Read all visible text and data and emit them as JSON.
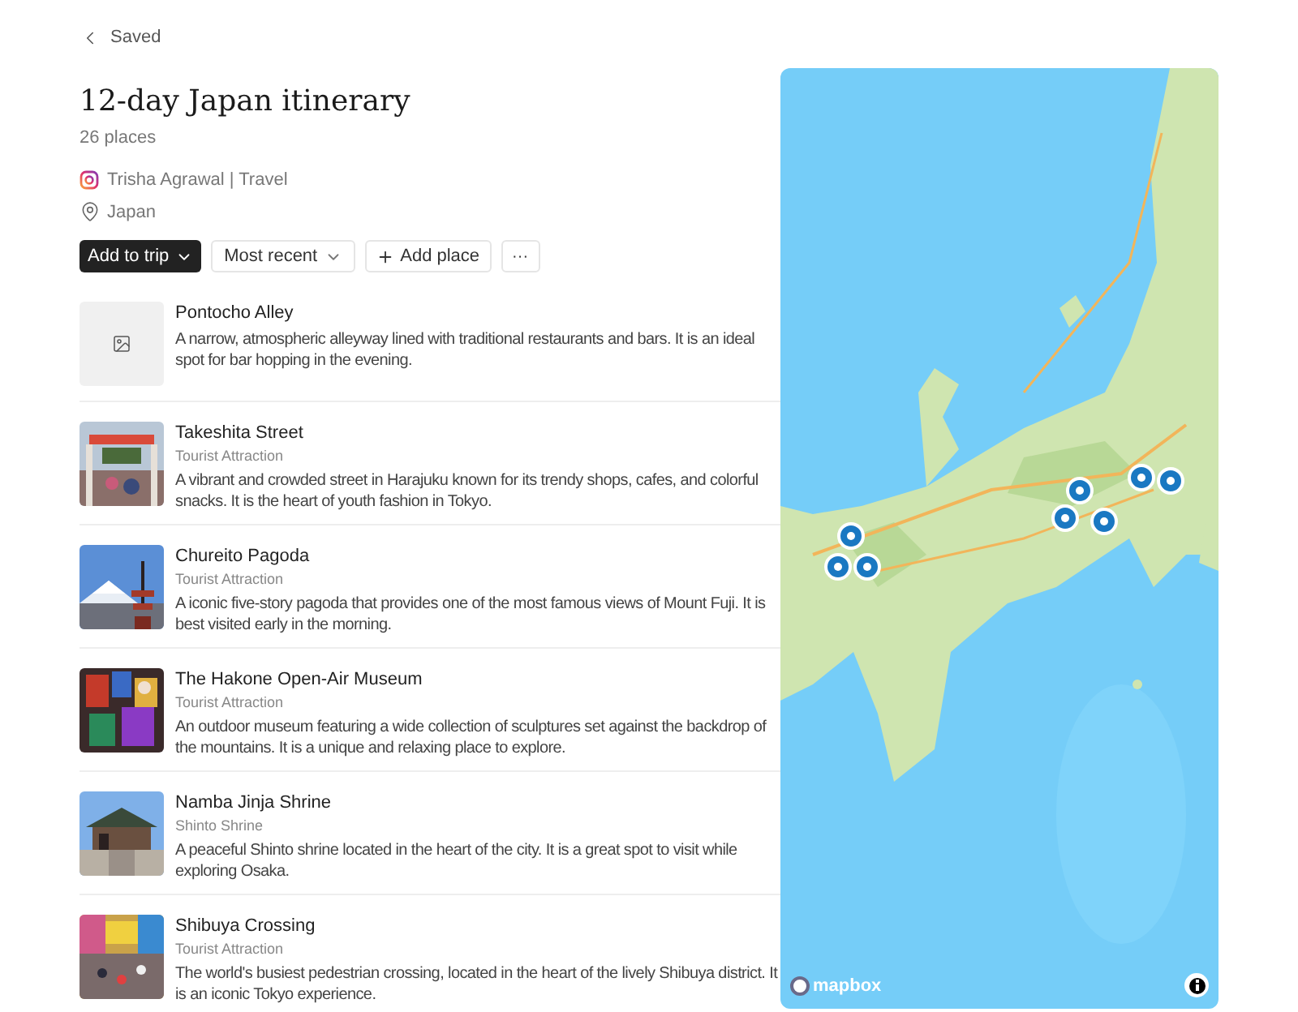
{
  "back_link": "Saved",
  "title": "12-day Japan itinerary",
  "count": "26 places",
  "author": "Trisha Agrawal | Travel",
  "location": "Japan",
  "toolbar": {
    "add_to_trip": "Add to trip",
    "sort": "Most recent",
    "add_place": "Add place",
    "more": "···"
  },
  "places": [
    {
      "name": "Pontocho Alley",
      "kind": "placeholder",
      "description": "A narrow, atmospheric alleyway lined with traditional restaurants and bars. It is an ideal spot for bar hopping in the evening."
    },
    {
      "name": "Takeshita Street",
      "category": "Tourist Attraction",
      "kind": "picture",
      "description": "A vibrant and crowded street in Harajuku known for its trendy shops, cafes, and colorful snacks. It is the heart of youth fashion in Tokyo."
    },
    {
      "name": "Chureito Pagoda",
      "category": "Tourist Attraction",
      "kind": "picture",
      "description": "A iconic five-story pagoda that provides one of the most famous views of Mount Fuji. It is best visited early in the morning."
    },
    {
      "name": "The Hakone Open-Air Museum",
      "category": "Tourist Attraction",
      "kind": "picture",
      "description": "An outdoor museum featuring a wide collection of sculptures set against the backdrop of the mountains. It is a unique and relaxing place to explore."
    },
    {
      "name": "Namba Jinja Shrine",
      "category": "Shinto Shrine",
      "kind": "picture",
      "description": "A peaceful Shinto shrine located in the heart of the city. It is a great spot to visit while exploring Osaka."
    },
    {
      "name": "Shibuya Crossing",
      "category": "Tourist Attraction",
      "kind": "picture",
      "description": "The world's busiest pedestrian crossing, located in the heart of the lively Shibuya district. It is an iconic Tokyo experience."
    }
  ],
  "map": {
    "kind": "picture",
    "attribution": "mapbox"
  }
}
